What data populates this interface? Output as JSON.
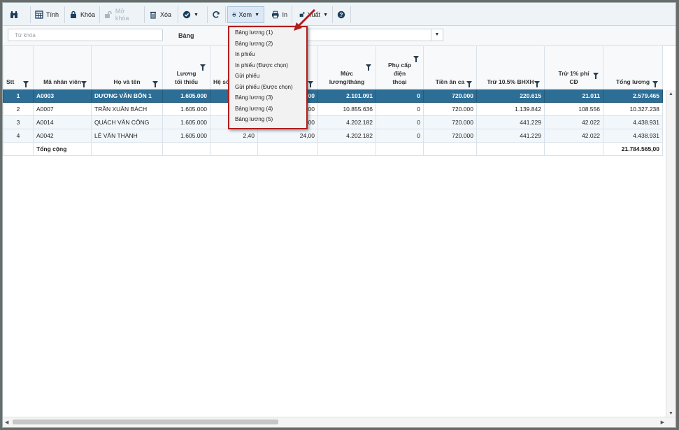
{
  "toolbar": {
    "tinh": "Tính",
    "khoa": "Khóa",
    "mo_khoa": "Mở khóa",
    "xoa": "Xóa",
    "xem": "Xem",
    "in": "In",
    "xuat": "Xuất"
  },
  "filter": {
    "search_placeholder": "Từ khóa",
    "bang_label": "Bảng"
  },
  "columns": [
    "Stt",
    "Mã nhân viên",
    "Họ và tên",
    "Lương tối thiểu",
    "Hệ số",
    "",
    "Mức lương/tháng",
    "Phụ cấp điện thoại",
    "Tiền ăn ca",
    "Trừ 10.5% BHXH",
    "Trừ 1% phí CĐ",
    "Tổng lương"
  ],
  "rows": [
    {
      "stt": "1",
      "ma": "A0003",
      "ten": "DƯƠNG VĂN BỐN 1",
      "luong": "1.605.000",
      "heso": "",
      "c6": "4,00",
      "muc": "2.101.091",
      "phucap": "0",
      "tienan": "720.000",
      "bhxh": "220.615",
      "cd": "21.011",
      "tong": "2.579.465"
    },
    {
      "stt": "2",
      "ma": "A0007",
      "ten": "TRẦN XUÂN BÁCH",
      "luong": "1.605.000",
      "heso": "",
      "c6": "4,00",
      "muc": "10.855.636",
      "phucap": "0",
      "tienan": "720.000",
      "bhxh": "1.139.842",
      "cd": "108.556",
      "tong": "10.327.238"
    },
    {
      "stt": "3",
      "ma": "A0014",
      "ten": "QUÁCH VĂN CÔNG",
      "luong": "1.605.000",
      "heso": "",
      "c6": "4,00",
      "muc": "4.202.182",
      "phucap": "0",
      "tienan": "720.000",
      "bhxh": "441.229",
      "cd": "42.022",
      "tong": "4.438.931"
    },
    {
      "stt": "4",
      "ma": "A0042",
      "ten": "LÊ VĂN THÀNH",
      "luong": "1.605.000",
      "heso": "2,40",
      "c6": "24,00",
      "muc": "4.202.182",
      "phucap": "0",
      "tienan": "720.000",
      "bhxh": "441.229",
      "cd": "42.022",
      "tong": "4.438.931"
    }
  ],
  "total": {
    "label": "Tổng cộng",
    "tong": "21.784.565,00"
  },
  "menu": [
    "Bảng lương (1)",
    "Bảng lương (2)",
    "In phiếu",
    "In phiếu (Được chọn)",
    "Gửi phiếu",
    "Gửi phiếu (Được chọn)",
    "Bảng lương (3)",
    "Bảng lương (4)",
    "Bảng lương (5)"
  ],
  "colors": {
    "selected_row": "#2d6e96",
    "menu_border": "#b01e1e"
  },
  "icons": [
    "binoculars-icon",
    "calculator-icon",
    "lock-icon",
    "unlock-icon",
    "trash-icon",
    "check-circle-icon",
    "refresh-icon",
    "printer-icon",
    "export-icon",
    "help-icon"
  ]
}
